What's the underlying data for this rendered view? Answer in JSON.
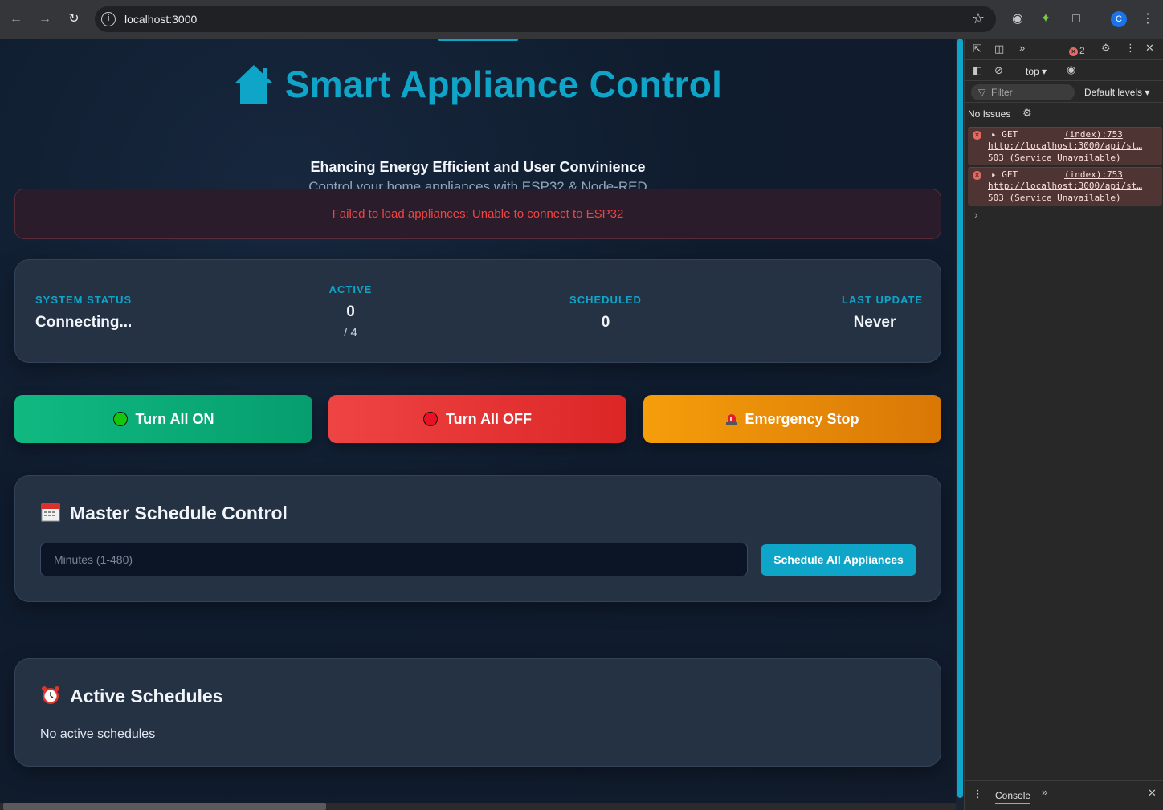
{
  "browser": {
    "url": "localhost:3000",
    "profile_initial": "C"
  },
  "header": {
    "title": "Smart Appliance Control",
    "subtitle": "Ehancing Energy Efficient and User Convinience",
    "tagline": "Control your home appliances with ESP32 & Node-RED"
  },
  "error": {
    "message": "Failed to load appliances: Unable to connect to ESP32"
  },
  "status": {
    "system_label": "SYSTEM STATUS",
    "system_value": "Connecting...",
    "active_label": "ACTIVE",
    "active_value": "0",
    "active_total": "/ 4",
    "scheduled_label": "SCHEDULED",
    "scheduled_value": "0",
    "update_label": "LAST UPDATE",
    "update_value": "Never"
  },
  "actions": {
    "all_on": "Turn All ON",
    "all_off": "Turn All OFF",
    "emergency": "Emergency Stop"
  },
  "master_schedule": {
    "title": "Master Schedule Control",
    "input_placeholder": "Minutes (1-480)",
    "input_value": "",
    "button": "Schedule All Appliances"
  },
  "active_schedules": {
    "title": "Active Schedules",
    "empty_text": "No active schedules"
  },
  "devtools": {
    "error_count": "2",
    "context": "top",
    "filter_placeholder": "Filter",
    "levels": "Default levels",
    "issues": "No Issues",
    "logs": [
      {
        "method": "GET",
        "source": "(index):753",
        "url": "http://localhost:3000/api/st…",
        "status": "503 (Service Unavailable)"
      },
      {
        "method": "GET",
        "source": "(index):753",
        "url": "http://localhost:3000/api/st…",
        "status": "503 (Service Unavailable)"
      }
    ],
    "drawer_tab": "Console"
  },
  "colors": {
    "accent": "#0ea5c9",
    "on": "#10b981",
    "off": "#ef4444",
    "emergency": "#f59e0b",
    "error_text": "#ef4444"
  }
}
